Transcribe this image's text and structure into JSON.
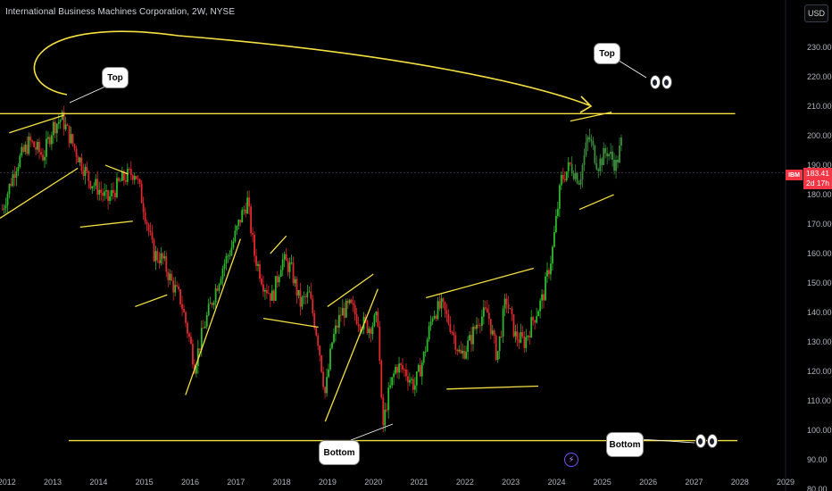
{
  "header": {
    "title": "International Business Machines Corporation, 2W, NYSE"
  },
  "currency_button": "USD",
  "price_tag": {
    "symbol": "IBM",
    "price": "183.41",
    "countdown": "2d 17h"
  },
  "annotations": {
    "top_left_label": "Top",
    "top_right_label": "Top",
    "bottom_center_label": "Bottom",
    "bottom_right_label": "Bottom"
  },
  "colors": {
    "up": "#2eb82e",
    "down": "#e0282f",
    "drawing": "#f5e142",
    "background": "#000000",
    "axis_text": "#b2b5be",
    "recent_candles": "#3c8c3c"
  },
  "chart_data": {
    "type": "candlestick",
    "title": "International Business Machines Corporation, 2W, NYSE",
    "x_ticks": [
      "2012",
      "2013",
      "2014",
      "2015",
      "2016",
      "2017",
      "2018",
      "2019",
      "2020",
      "2021",
      "2022",
      "2023",
      "2024",
      "2025",
      "2026",
      "2027",
      "2028",
      "2029"
    ],
    "y_ticks": [
      "230.00",
      "220.00",
      "210.00",
      "200.00",
      "190.00",
      "180.00",
      "170.00",
      "160.00",
      "150.00",
      "140.00",
      "130.00",
      "120.00",
      "110.00",
      "100.00",
      "90.00",
      "80.00"
    ],
    "ylim": [
      80,
      237
    ],
    "xlim": [
      2011.85,
      2029.0
    ],
    "last_price": 183.41,
    "series": [
      {
        "name": "IBM",
        "close_path": [
          [
            2011.9,
            175
          ],
          [
            2012.2,
            190
          ],
          [
            2012.5,
            198
          ],
          [
            2012.8,
            193
          ],
          [
            2013.0,
            203
          ],
          [
            2013.2,
            206
          ],
          [
            2013.5,
            195
          ],
          [
            2013.8,
            185
          ],
          [
            2014.0,
            182
          ],
          [
            2014.2,
            178
          ],
          [
            2014.5,
            185
          ],
          [
            2014.8,
            188
          ],
          [
            2015.0,
            175
          ],
          [
            2015.2,
            160
          ],
          [
            2015.4,
            158
          ],
          [
            2015.6,
            150
          ],
          [
            2015.8,
            144
          ],
          [
            2016.0,
            130
          ],
          [
            2016.1,
            122
          ],
          [
            2016.3,
            135
          ],
          [
            2016.5,
            145
          ],
          [
            2016.7,
            155
          ],
          [
            2016.9,
            162
          ],
          [
            2017.1,
            172
          ],
          [
            2017.25,
            178
          ],
          [
            2017.4,
            160
          ],
          [
            2017.6,
            150
          ],
          [
            2017.8,
            145
          ],
          [
            2018.0,
            158
          ],
          [
            2018.2,
            155
          ],
          [
            2018.4,
            143
          ],
          [
            2018.6,
            146
          ],
          [
            2018.8,
            130
          ],
          [
            2018.95,
            112
          ],
          [
            2019.1,
            130
          ],
          [
            2019.3,
            140
          ],
          [
            2019.5,
            142
          ],
          [
            2019.7,
            137
          ],
          [
            2019.9,
            135
          ],
          [
            2020.1,
            138
          ],
          [
            2020.2,
            100
          ],
          [
            2020.3,
            110
          ],
          [
            2020.5,
            122
          ],
          [
            2020.7,
            120
          ],
          [
            2020.9,
            115
          ],
          [
            2021.1,
            125
          ],
          [
            2021.3,
            140
          ],
          [
            2021.5,
            142
          ],
          [
            2021.7,
            135
          ],
          [
            2021.9,
            125
          ],
          [
            2022.1,
            130
          ],
          [
            2022.3,
            138
          ],
          [
            2022.5,
            140
          ],
          [
            2022.7,
            125
          ],
          [
            2022.9,
            145
          ],
          [
            2023.1,
            132
          ],
          [
            2023.3,
            130
          ],
          [
            2023.5,
            138
          ],
          [
            2023.7,
            145
          ],
          [
            2023.9,
            160
          ],
          [
            2024.1,
            185
          ],
          [
            2024.3,
            190
          ],
          [
            2024.5,
            185
          ],
          [
            2024.7,
            200
          ],
          [
            2024.9,
            190
          ],
          [
            2025.1,
            195
          ],
          [
            2025.3,
            190
          ],
          [
            2025.45,
            200
          ]
        ]
      }
    ],
    "drawings": [
      {
        "name": "resistance-line",
        "points": [
          [
            2011.85,
            207.5
          ],
          [
            2027.9,
            207.5
          ]
        ]
      },
      {
        "name": "support-line",
        "points": [
          [
            2013.35,
            96.5
          ],
          [
            2027.95,
            96.5
          ]
        ]
      },
      {
        "name": "wedge-2012-lower",
        "points": [
          [
            2011.85,
            172
          ],
          [
            2013.55,
            189
          ]
        ]
      },
      {
        "name": "wedge-2012-upper",
        "points": [
          [
            2012.05,
            201
          ],
          [
            2013.25,
            207
          ]
        ]
      },
      {
        "name": "wedge-2014-upper",
        "points": [
          [
            2014.15,
            190
          ],
          [
            2014.65,
            187
          ]
        ]
      },
      {
        "name": "wedge-2014-lower",
        "points": [
          [
            2013.6,
            169
          ],
          [
            2014.75,
            171
          ]
        ]
      },
      {
        "name": "flag-2015",
        "points": [
          [
            2014.8,
            142
          ],
          [
            2015.5,
            146
          ]
        ]
      },
      {
        "name": "trend-2016",
        "points": [
          [
            2015.9,
            112
          ],
          [
            2017.1,
            165
          ]
        ]
      },
      {
        "name": "wedge-2017-upper",
        "points": [
          [
            2017.75,
            160
          ],
          [
            2018.1,
            166
          ]
        ]
      },
      {
        "name": "wedge-2017-lower",
        "points": [
          [
            2017.6,
            138
          ],
          [
            2018.8,
            135
          ]
        ]
      },
      {
        "name": "trend-2019",
        "points": [
          [
            2018.95,
            103
          ],
          [
            2020.1,
            148
          ]
        ]
      },
      {
        "name": "wedge-2019-upper",
        "points": [
          [
            2019.0,
            142
          ],
          [
            2020.0,
            153
          ]
        ]
      },
      {
        "name": "channel-2021-upper",
        "points": [
          [
            2021.15,
            145
          ],
          [
            2023.5,
            155
          ]
        ]
      },
      {
        "name": "channel-2021-lower",
        "points": [
          [
            2021.6,
            114
          ],
          [
            2023.6,
            115
          ]
        ]
      },
      {
        "name": "wedge-2024-lower",
        "points": [
          [
            2024.5,
            175
          ],
          [
            2025.25,
            180
          ]
        ]
      },
      {
        "name": "wedge-2024-upper",
        "points": [
          [
            2024.3,
            205
          ],
          [
            2025.2,
            208
          ]
        ]
      }
    ],
    "grid": false,
    "legend": "none"
  }
}
